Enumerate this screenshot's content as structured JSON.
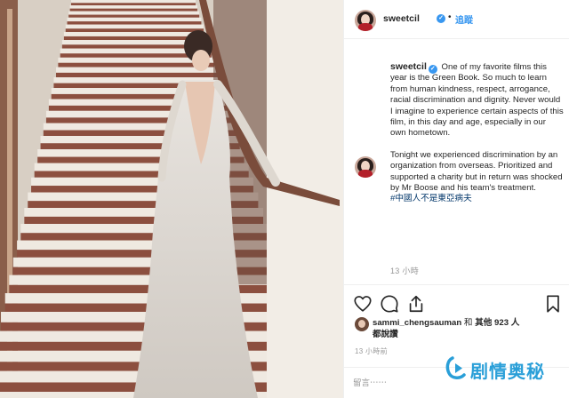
{
  "header": {
    "username": "sweetcil",
    "verified": true,
    "separator": "•",
    "follow_label": "追蹤"
  },
  "caption": {
    "username": "sweetcil",
    "paragraph1": "One of my favorite films this year is the Green Book. So much to learn from human kindness, respect, arrogance, racial discrimination and dignity. Never would I imagine to experience certain aspects of this film, in this day and age, especially in our own hometown.",
    "paragraph2": "Tonight we experienced discrimination by an organization from overseas. Prioritized and supported a charity but in return was shocked by Mr Boose and his team's treatment.",
    "hashtag": "#中國人不是東亞病夫",
    "timestamp": "13 小時"
  },
  "actions": {
    "like_icon": "heart-icon",
    "comment_icon": "comment-icon",
    "share_icon": "share-icon",
    "save_icon": "bookmark-icon"
  },
  "likes": {
    "user": "sammi_chengsauman",
    "connector": " 和 ",
    "others_label": "其他 923 人",
    "suffix": "都說讚"
  },
  "post_time": "13 小時前",
  "comment": {
    "placeholder": "留言⋯⋯"
  },
  "watermark": {
    "text": "剧情奥秘"
  },
  "colors": {
    "link_blue": "#3897f0",
    "hashtag": "#003569",
    "muted": "#999999",
    "text": "#262626",
    "watermark": "#2a9fd8"
  }
}
